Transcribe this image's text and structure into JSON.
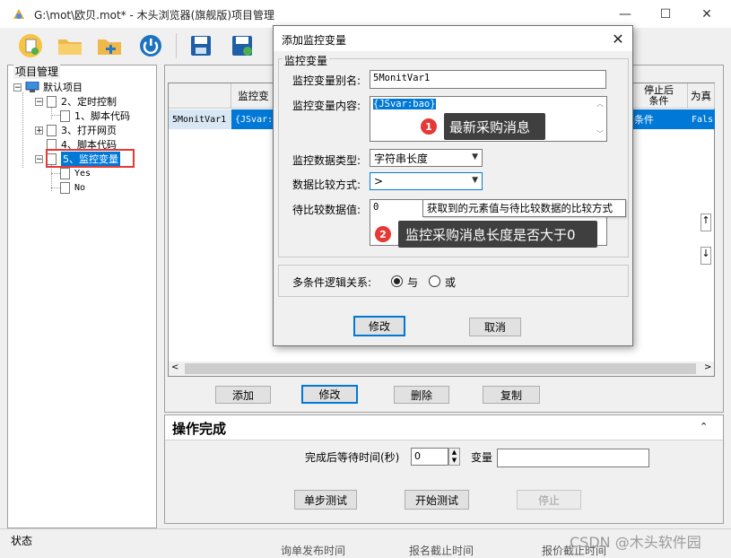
{
  "window": {
    "title": "G:\\mot\\欧贝.mot* - 木头浏览器(旗舰版)项目管理",
    "minimize_icon": "minimize-icon",
    "maximize_icon": "maximize-icon",
    "close_icon": "close-icon"
  },
  "toolbar": {
    "icons": [
      "new-file-icon",
      "open-folder-icon",
      "add-folder-icon",
      "power-icon",
      "save-icon",
      "save-as-icon"
    ]
  },
  "left_panel": {
    "title": "项目管理",
    "tree": [
      {
        "label": "默认项目",
        "icon": "computer-icon"
      },
      {
        "label": "2、定时控制"
      },
      {
        "label": "1、脚本代码"
      },
      {
        "label": "3、打开网页"
      },
      {
        "label": "4、脚本代码"
      },
      {
        "label": "5、监控变量",
        "selected": true
      },
      {
        "label": "Yes"
      },
      {
        "label": "No"
      }
    ]
  },
  "grid": {
    "headers": [
      "监控变",
      "停止后\n条件",
      "为真"
    ],
    "row": {
      "name": "5MonitVar1",
      "content": "{JSvar:l",
      "stop_cond": "条件",
      "true_val": "Fals"
    }
  },
  "right_buttons": {
    "add": "添加",
    "modify": "修改",
    "delete": "删除",
    "copy": "复制"
  },
  "ops": {
    "title": "操作完成",
    "wait_label": "完成后等待时间(秒)",
    "wait_value": "0",
    "var_label": "变量",
    "var_value": "",
    "single_step": "单步测试",
    "start_test": "开始测试",
    "stop": "停止"
  },
  "status": {
    "label": "状态"
  },
  "bottom_peek": [
    "询单发布时间",
    "报名截止时间",
    "报价截止时间"
  ],
  "watermark": "CSDN @木头软件园",
  "dialog": {
    "title": "添加监控变量",
    "group_title": "监控变量",
    "alias_label": "监控变量别名:",
    "alias_value": "5MonitVar1",
    "content_label": "监控变量内容:",
    "content_value": "{JSvar:bao}",
    "datatype_label": "监控数据类型:",
    "datatype_value": "字符串长度",
    "compare_label": "数据比较方式:",
    "compare_value": ">",
    "compare_data_label": "待比较数据值:",
    "compare_data_value": "0",
    "logic_label": "多条件逻辑关系:",
    "logic_and": "与",
    "logic_or": "或",
    "logic_selected": "与",
    "ok": "修改",
    "cancel": "取消",
    "tooltip": "获取到的元素值与待比较数据的比较方式"
  },
  "callouts": [
    {
      "number": "1",
      "text": "最新采购消息"
    },
    {
      "number": "2",
      "text": "监控采购消息长度是否大于0"
    }
  ],
  "colors": {
    "accent": "#0078d7",
    "highlight": "#e53935",
    "callout_bg": "#3f3f3f"
  }
}
